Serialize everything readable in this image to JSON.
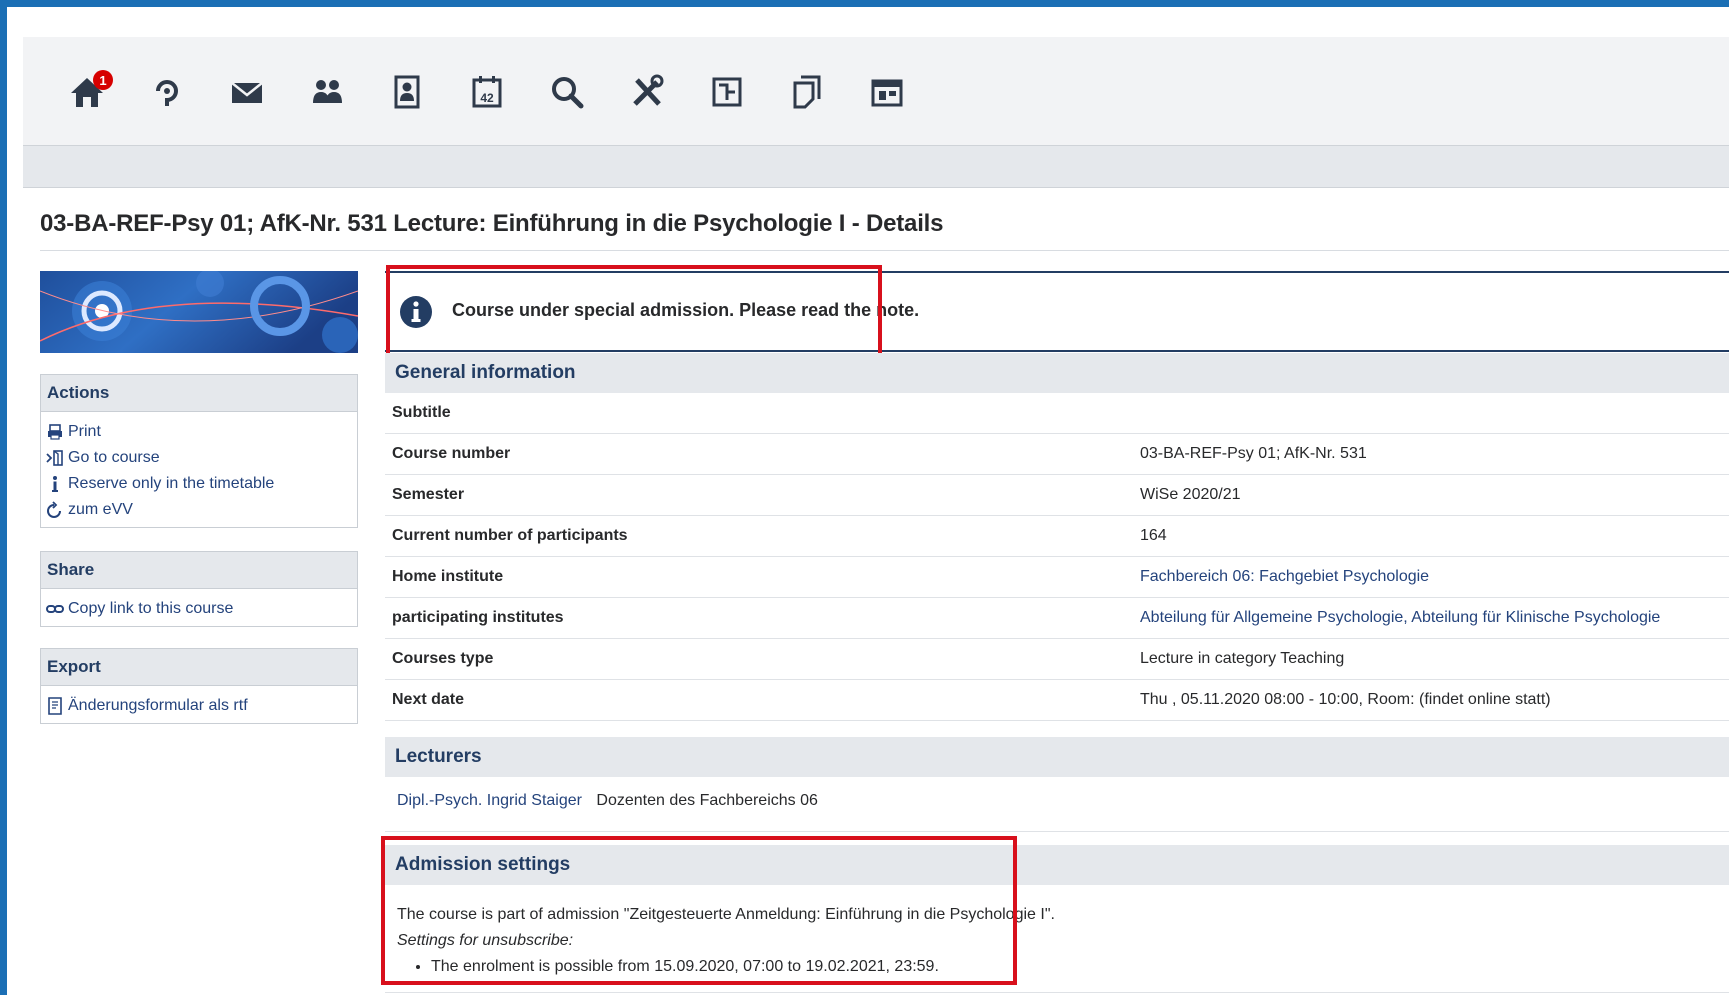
{
  "nav": {
    "notification_count": "1",
    "icons": [
      "home-icon",
      "circle-icon",
      "mail-icon",
      "community-icon",
      "profile-icon",
      "calendar-icon",
      "search-icon",
      "tools-icon",
      "timetable-icon",
      "documents-icon",
      "plugin-icon"
    ],
    "calendar_day": "42"
  },
  "page": {
    "title": "03-BA-REF-Psy 01; AfK-Nr. 531 Lecture: Einführung in die Psychologie I - Details"
  },
  "sidebar": {
    "actions": {
      "title": "Actions",
      "items": [
        {
          "label": "Print",
          "icon": "print-icon"
        },
        {
          "label": "Go to course",
          "icon": "enter-icon"
        },
        {
          "label": "Reserve only in the timetable",
          "icon": "info-icon"
        },
        {
          "label": "zum eVV",
          "icon": "refresh-icon"
        }
      ]
    },
    "share": {
      "title": "Share",
      "items": [
        {
          "label": "Copy link to this course",
          "icon": "link-icon"
        }
      ]
    },
    "export": {
      "title": "Export",
      "items": [
        {
          "label": "Änderungsformular als rtf",
          "icon": "file-icon"
        }
      ]
    }
  },
  "info_message": "Course under special admission. Please read the note.",
  "general_info": {
    "title": "General information",
    "rows": [
      {
        "key": "Subtitle",
        "value": ""
      },
      {
        "key": "Course number",
        "value": "03-BA-REF-Psy 01; AfK-Nr. 531"
      },
      {
        "key": "Semester",
        "value": "WiSe 2020/21"
      },
      {
        "key": "Current number of participants",
        "value": "164"
      },
      {
        "key": "Home institute",
        "value": "Fachbereich 06: Fachgebiet Psychologie"
      },
      {
        "key": "participating institutes",
        "value": "Abteilung für Allgemeine Psychologie, Abteilung für Klinische Psychologie"
      },
      {
        "key": "Courses type",
        "value": "Lecture in category Teaching"
      },
      {
        "key": "Next date",
        "value": "Thu , 05.11.2020 08:00 - 10:00, Room: (findet online statt)"
      }
    ]
  },
  "lecturers": {
    "title": "Lecturers",
    "name": "Dipl.-Psych. Ingrid Staiger",
    "role": "Dozenten des Fachbereichs 06"
  },
  "admission": {
    "title": "Admission settings",
    "text": "The course is part of admission \"Zeitgesteuerte Anmeldung: Einführung in die Psychologie I\".",
    "unsubscribe_label": "Settings for unsubscribe:",
    "bullet": "The enrolment is possible from 15.09.2020, 07:00 to 19.02.2021, 23:59."
  },
  "colors": {
    "frame": "#1b6fb5",
    "heading": "#233d63",
    "link": "#24437c",
    "highlight": "#d8101c"
  }
}
